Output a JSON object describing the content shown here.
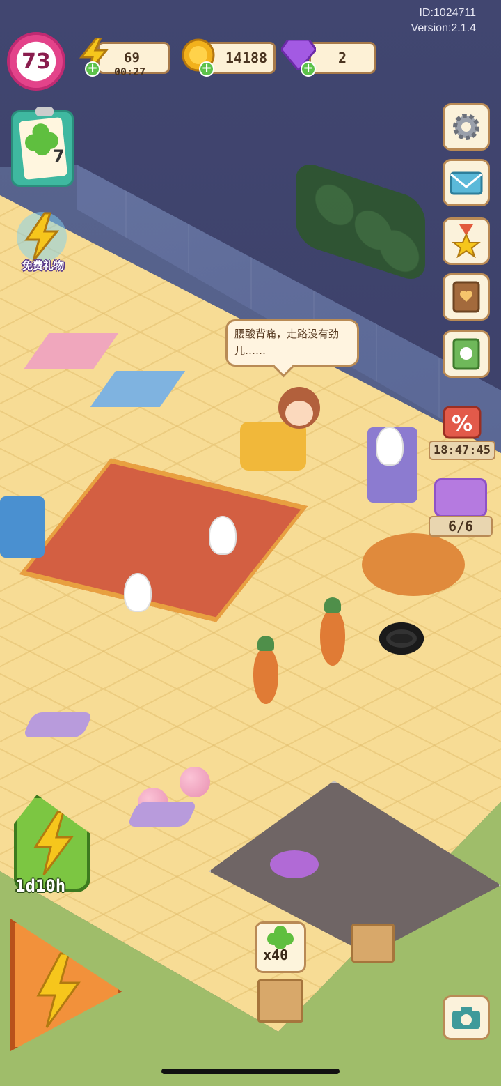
{
  "header": {
    "player_id": "ID:1024711",
    "version": "Version:2.1.4"
  },
  "hud": {
    "level": "73",
    "energy": {
      "value": "69",
      "timer": "00:27",
      "icon": "lightning-icon"
    },
    "coins": {
      "value": "14188",
      "icon": "coin-icon"
    },
    "gems": {
      "value": "2",
      "icon": "gem-icon"
    },
    "add_symbol": "+"
  },
  "left_panel": {
    "task_board": {
      "count": "7",
      "icon": "clover-icon"
    },
    "free_gift": {
      "label": "免费礼物",
      "icon": "gift-icon"
    },
    "boost": {
      "timer": "1d10h",
      "icon": "lightning-icon"
    },
    "main_boost": {
      "icon": "lightning-icon"
    }
  },
  "right_panel": {
    "buttons": [
      {
        "name": "settings",
        "icon": "gear-icon"
      },
      {
        "name": "mail",
        "icon": "mail-icon"
      },
      {
        "name": "achievements",
        "icon": "medal-icon"
      },
      {
        "name": "collection-book",
        "icon": "book-icon"
      },
      {
        "name": "album",
        "icon": "album-icon"
      }
    ],
    "sale": {
      "timer": "18:47:45",
      "icon": "percent-icon"
    },
    "jar": {
      "count": "6/6",
      "icon": "jar-icon"
    }
  },
  "scene": {
    "speech_bubble": "腰酸背痛，走路没有劲儿……",
    "crate_reward": "x40"
  },
  "colors": {
    "hud_border": "#a77a4a",
    "level_ring": "#e3438a",
    "plus_green": "#5cc24a",
    "floor": "#f7dc95",
    "accent_orange": "#f2913b",
    "accent_green": "#7cc642"
  }
}
